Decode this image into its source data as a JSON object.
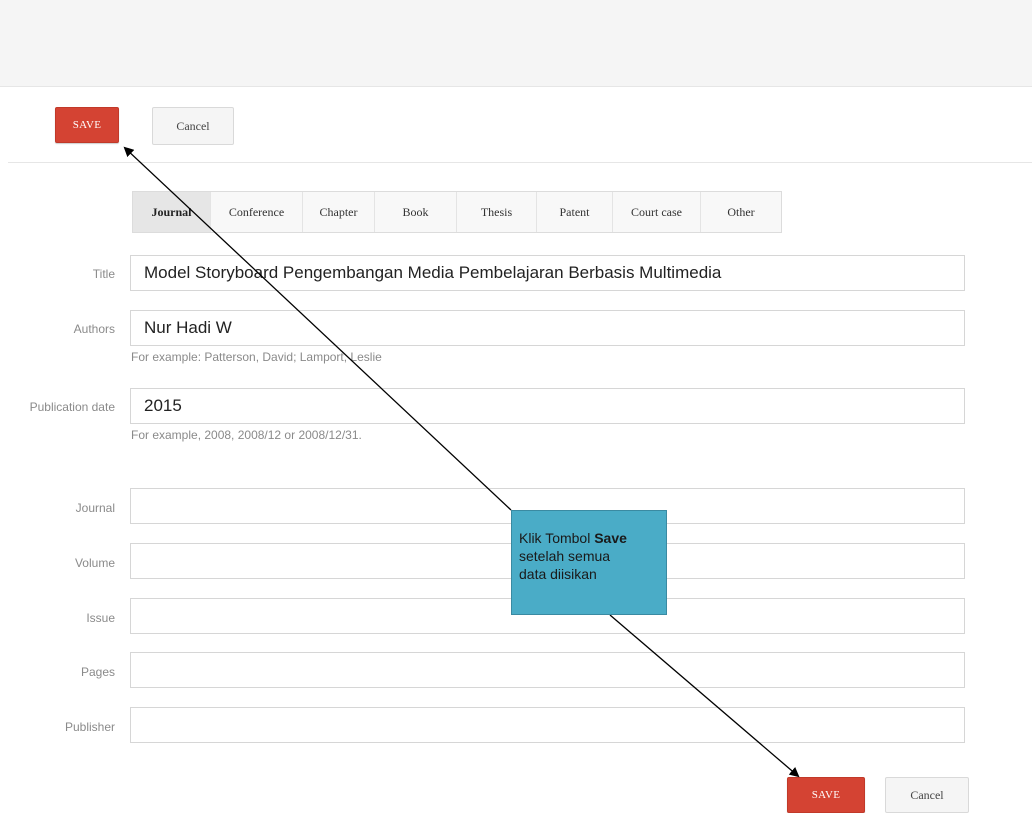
{
  "toolbar": {
    "save_label": "SAVE",
    "cancel_label": "Cancel"
  },
  "tabs": [
    {
      "label": "Journal",
      "active": true
    },
    {
      "label": "Conference",
      "active": false
    },
    {
      "label": "Chapter",
      "active": false
    },
    {
      "label": "Book",
      "active": false
    },
    {
      "label": "Thesis",
      "active": false
    },
    {
      "label": "Patent",
      "active": false
    },
    {
      "label": "Court case",
      "active": false
    },
    {
      "label": "Other",
      "active": false
    }
  ],
  "fields": {
    "title": {
      "label": "Title",
      "value": "Model Storyboard Pengembangan Media Pembelajaran Berbasis Multimedia"
    },
    "authors": {
      "label": "Authors",
      "value": "Nur Hadi W",
      "help": "For example: Patterson, David; Lamport, Leslie"
    },
    "publication_date": {
      "label": "Publication date",
      "value": "2015",
      "help": "For example, 2008, 2008/12 or 2008/12/31."
    },
    "journal": {
      "label": "Journal",
      "value": ""
    },
    "volume": {
      "label": "Volume",
      "value": ""
    },
    "issue": {
      "label": "Issue",
      "value": ""
    },
    "pages": {
      "label": "Pages",
      "value": ""
    },
    "publisher": {
      "label": "Publisher",
      "value": ""
    }
  },
  "callout": {
    "prefix": "Klik Tombol ",
    "emphasis": "Save",
    "line2": "setelah semua",
    "line3": "data diisikan"
  },
  "colors": {
    "save_button": "#d44333",
    "callout_background": "#4aacc7"
  }
}
